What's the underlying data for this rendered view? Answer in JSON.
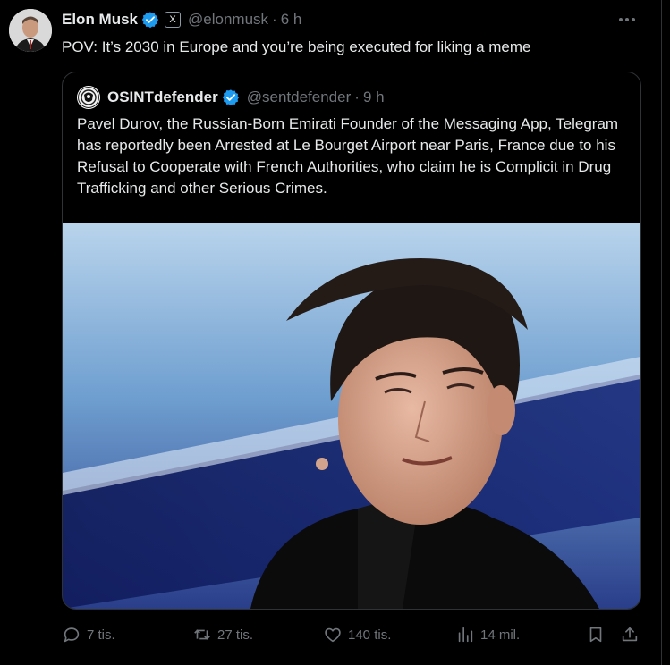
{
  "tweet": {
    "author_name": "Elon Musk",
    "author_handle": "@elonmusk",
    "separator": "·",
    "time": "6 h",
    "affiliate_badge": "X",
    "text": "POV: It’s 2030 in Europe and you’re being executed for liking a meme",
    "more_icon": "more-dots-icon",
    "verified_color": "#1d9bf0"
  },
  "quoted": {
    "author_name": "OSINTdefender",
    "author_handle": "@sentdefender",
    "separator": "·",
    "time": "9 h",
    "text": "Pavel Durov, the Russian-Born Emirati Founder of the Messaging App, Telegram has reportedly been Arrested at Le Bourget Airport near Paris, France due to his Refusal to Cooperate with French Authorities, who claim he is Complicit in Drug Trafficking and other Serious Crimes."
  },
  "actions": {
    "replies": "7 tis.",
    "reposts": "27 tis.",
    "likes": "140 tis.",
    "views": "14 mil."
  }
}
